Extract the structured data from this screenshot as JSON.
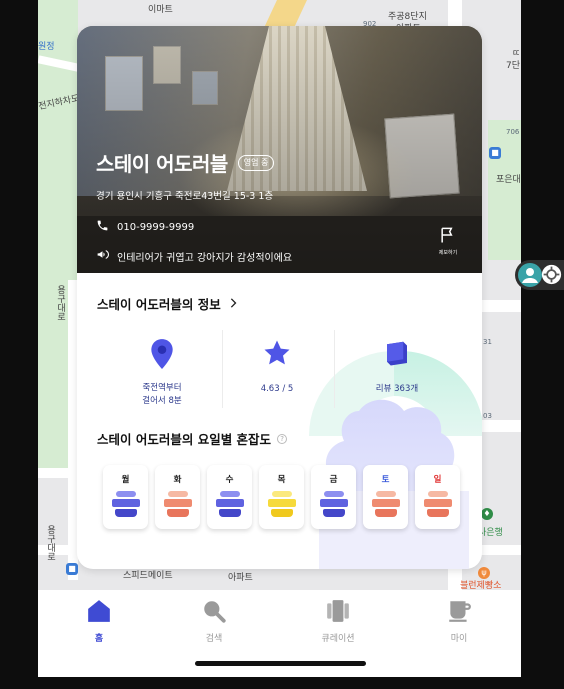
{
  "map": {
    "labels": [
      "이마트",
      "주공8단지",
      "아파트",
      "902",
      "원정",
      "전지하차도",
      "706",
      "포은대",
      "ㄸ",
      "7단",
      "용구대로",
      "용구대로",
      "스피드메이트",
      "아파트",
      "블런제빵소",
      "사은행",
      "03",
      "31",
      "901"
    ]
  },
  "store": {
    "name": "스테이 어도러블",
    "status_badge": "영업 중",
    "address": "경기 용인시 기흥구 죽전로43번길 15-3 1층",
    "phone": "010-9999-9999",
    "notice": "인테리어가 귀엽고 강아지가 감성적이에요",
    "flag_label": "제보하기"
  },
  "info_section": {
    "title": "스테이 어도러블의 정보",
    "chevron": "chevron-right-icon",
    "stats": [
      {
        "icon": "location-pin-icon",
        "label_line1": "죽전역부터",
        "label_line2": "걸어서 8분"
      },
      {
        "icon": "star-icon",
        "label_line1": "4.63 / 5"
      },
      {
        "icon": "review-book-icon",
        "label_line1": "리뷰 363개"
      }
    ]
  },
  "congestion": {
    "title": "스테이 어도러블의 요일별 혼잡도",
    "days": [
      {
        "day": "월",
        "color": "#222222",
        "level": "low"
      },
      {
        "day": "화",
        "color": "#222222",
        "level": "high"
      },
      {
        "day": "수",
        "color": "#222222",
        "level": "low"
      },
      {
        "day": "목",
        "color": "#222222",
        "level": "medium"
      },
      {
        "day": "금",
        "color": "#222222",
        "level": "low"
      },
      {
        "day": "토",
        "color": "#3b5bdb",
        "level": "high"
      },
      {
        "day": "일",
        "color": "#e03131",
        "level": "high"
      }
    ],
    "level_colors": {
      "low": [
        "#8d8ff0",
        "#5f62e0",
        "#4447c9"
      ],
      "medium": [
        "#fbe97e",
        "#f6da3c",
        "#f0c91d"
      ],
      "high": [
        "#f6b9a3",
        "#ef8b70",
        "#e8755c"
      ]
    }
  },
  "tabbar": {
    "tabs": [
      {
        "label": "홈",
        "icon": "home-icon",
        "active": true
      },
      {
        "label": "검색",
        "icon": "search-icon",
        "active": false
      },
      {
        "label": "큐레이션",
        "icon": "curation-icon",
        "active": false
      },
      {
        "label": "마이",
        "icon": "my-cup-icon",
        "active": false
      }
    ],
    "active_color": "#3f4bd3",
    "inactive_color": "#9a9a9a"
  }
}
